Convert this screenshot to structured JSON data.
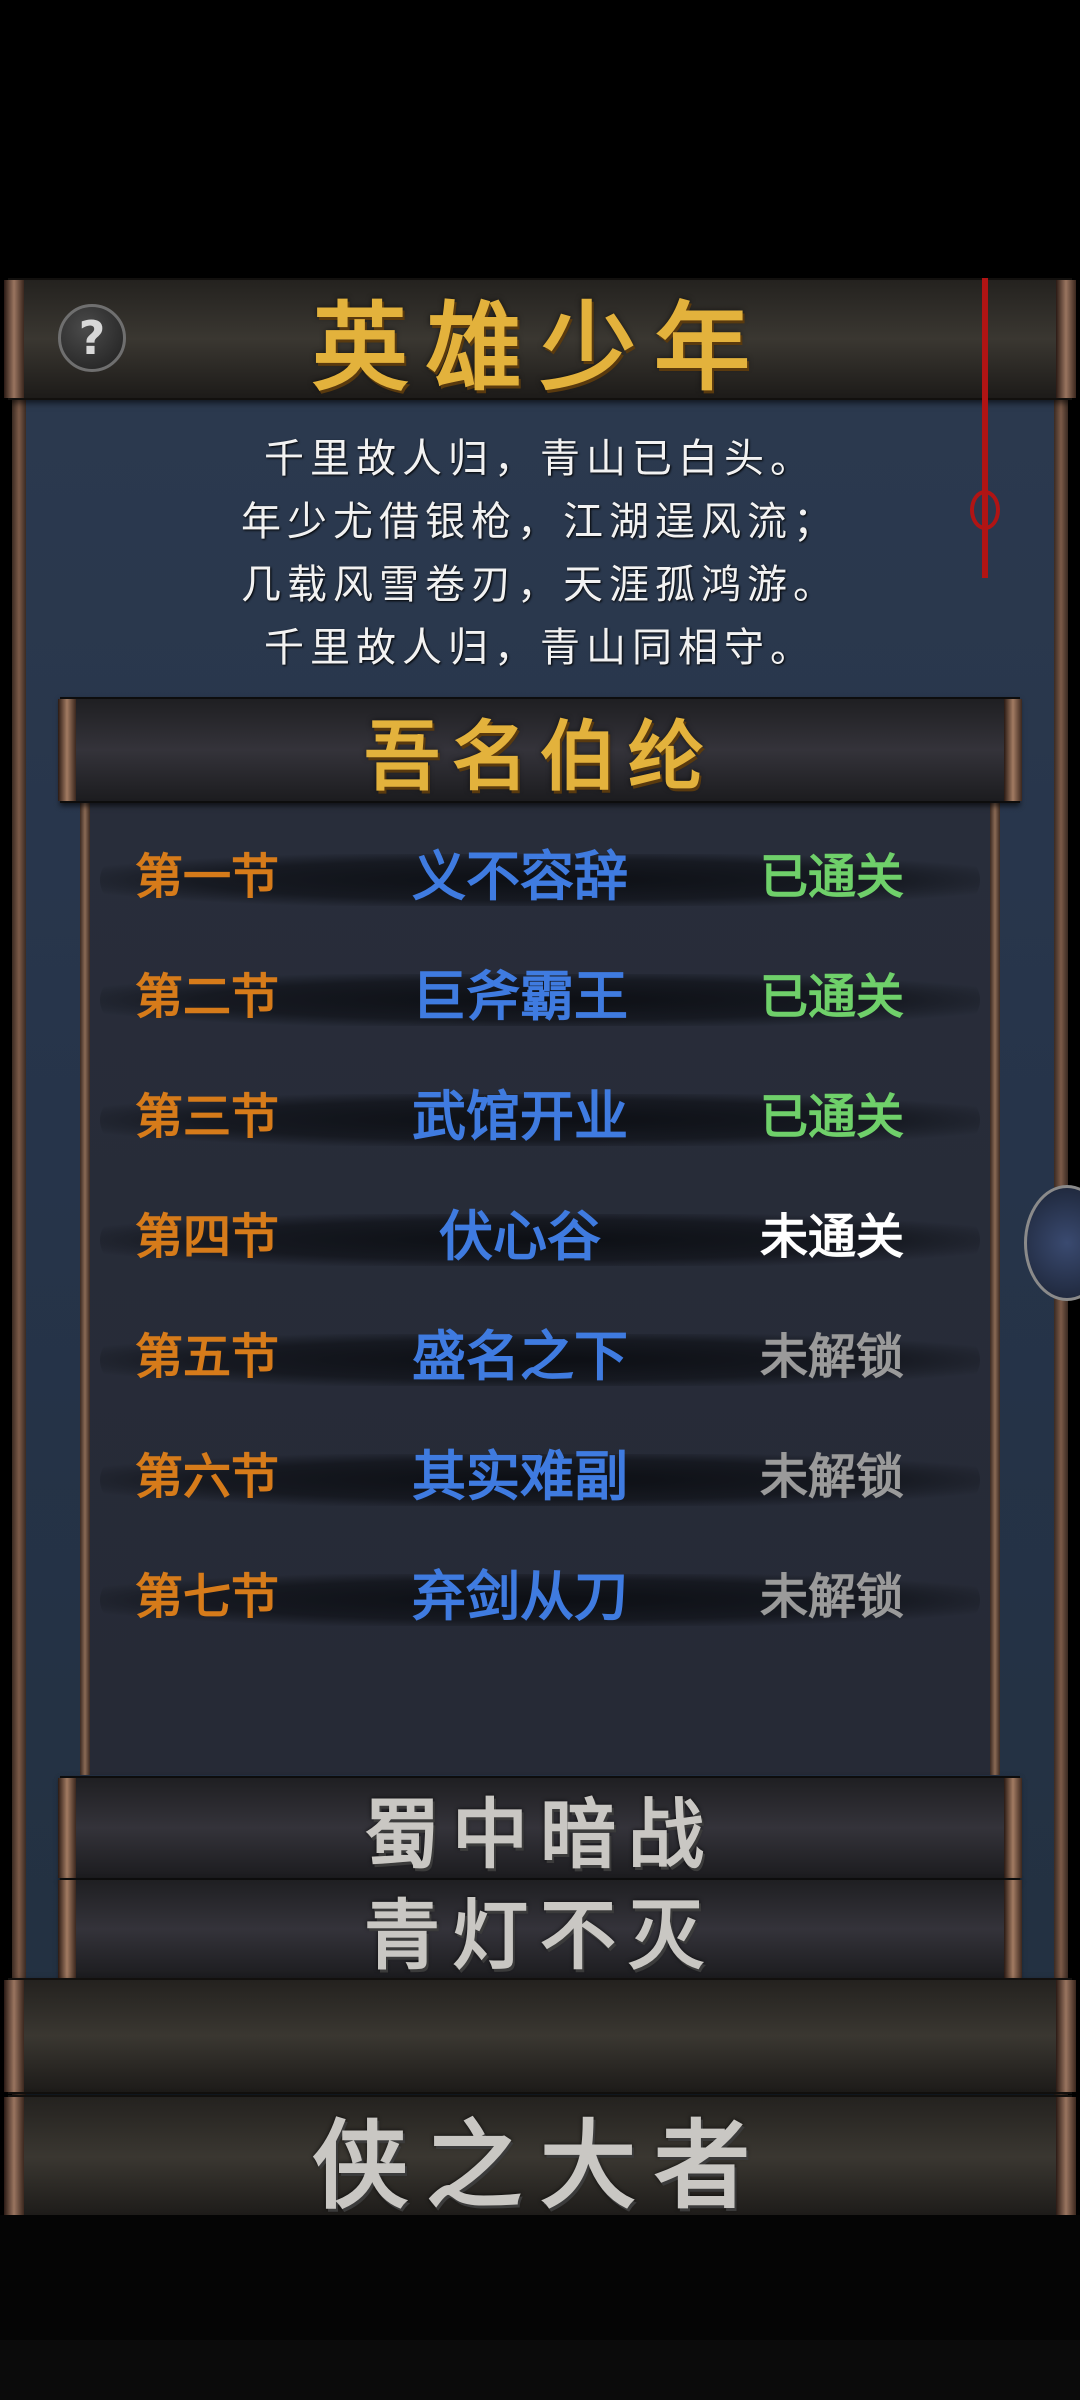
{
  "header": {
    "title": "英雄少年",
    "help_symbol": "?"
  },
  "poem": [
    "千里故人归，青山已白头。",
    "年少尤借银枪，江湖逞风流；",
    "几载风雪卷刃，天涯孤鸿游。",
    "千里故人归，青山同相守。"
  ],
  "section": {
    "title": "吾名伯纶"
  },
  "chapters": [
    {
      "num": "第一节",
      "name": "义不容辞",
      "status": "已通关",
      "status_color": "#6fd06a"
    },
    {
      "num": "第二节",
      "name": "巨斧霸王",
      "status": "已通关",
      "status_color": "#6fd06a"
    },
    {
      "num": "第三节",
      "name": "武馆开业",
      "status": "已通关",
      "status_color": "#6fd06a"
    },
    {
      "num": "第四节",
      "name": "伏心谷",
      "status": "未通关",
      "status_color": "#ffffff"
    },
    {
      "num": "第五节",
      "name": "盛名之下",
      "status": "未解锁",
      "status_color": "#9a9a9a"
    },
    {
      "num": "第六节",
      "name": "其实难副",
      "status": "未解锁",
      "status_color": "#9a9a9a"
    },
    {
      "num": "第七节",
      "name": "弃剑从刀",
      "status": "未解锁",
      "status_color": "#9a9a9a"
    }
  ],
  "collapsed_sections": [
    "蜀中暗战",
    "青灯不灭"
  ],
  "next_story": {
    "title": "侠之大者"
  },
  "colors": {
    "chapter_num": "#d67b1a",
    "chapter_name": "#3f7be0",
    "title_gold": "#e3b23c",
    "title_grey": "#c9c7c3"
  }
}
